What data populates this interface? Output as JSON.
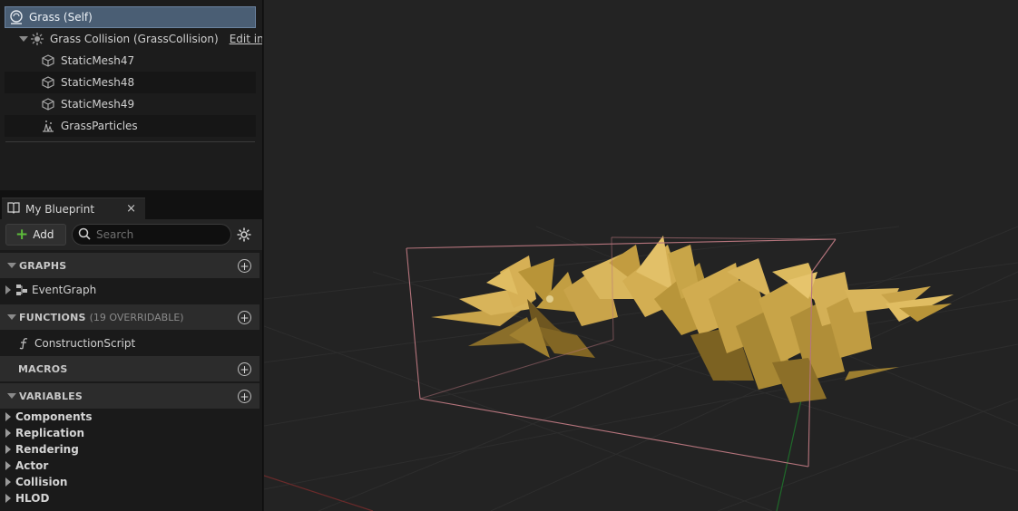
{
  "components": {
    "items": [
      {
        "label": "Grass (Self)",
        "icon": "actor-self-icon"
      },
      {
        "label": "Grass Collision (GrassCollision)",
        "link": "Edit in",
        "icon": "collision-component-icon"
      },
      {
        "label": "StaticMesh47",
        "icon": "static-mesh-icon"
      },
      {
        "label": "StaticMesh48",
        "icon": "static-mesh-icon"
      },
      {
        "label": "StaticMesh49",
        "icon": "static-mesh-icon"
      },
      {
        "label": "GrassParticles",
        "icon": "particle-system-icon"
      }
    ]
  },
  "my_blueprint": {
    "tab_label": "My Blueprint",
    "close": "×",
    "add_label": "Add",
    "search_placeholder": "Search",
    "sections": {
      "graphs": {
        "title": "GRAPHS",
        "items": [
          "EventGraph"
        ]
      },
      "functions": {
        "title": "FUNCTIONS",
        "subtitle": "(19 OVERRIDABLE)",
        "items": [
          "ConstructionScript"
        ]
      },
      "macros": {
        "title": "MACROS"
      },
      "variables": {
        "title": "VARIABLES",
        "items": [
          "Components",
          "Replication",
          "Rendering",
          "Actor",
          "Collision",
          "HLOD"
        ]
      }
    }
  },
  "colors": {
    "selection": "#4a5e74",
    "grass": "#c9a44a",
    "bounds_box": "#b5747c",
    "add_plus": "#5dbb3b"
  }
}
